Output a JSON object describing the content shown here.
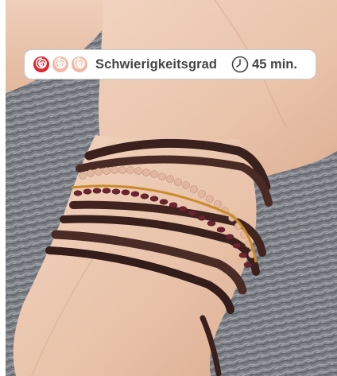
{
  "difficulty": {
    "label": "Schwierigkeitsgrad",
    "level": 1,
    "max_level": 3,
    "icons": [
      "spiral-icon",
      "spiral-icon",
      "spiral-icon"
    ],
    "active_color": "#e0252f",
    "inactive_color": "#f3b7a4"
  },
  "time": {
    "icon": "clock-icon",
    "value": "45 min."
  },
  "photo": {
    "subject": "wrist-with-wrap-bracelet"
  }
}
